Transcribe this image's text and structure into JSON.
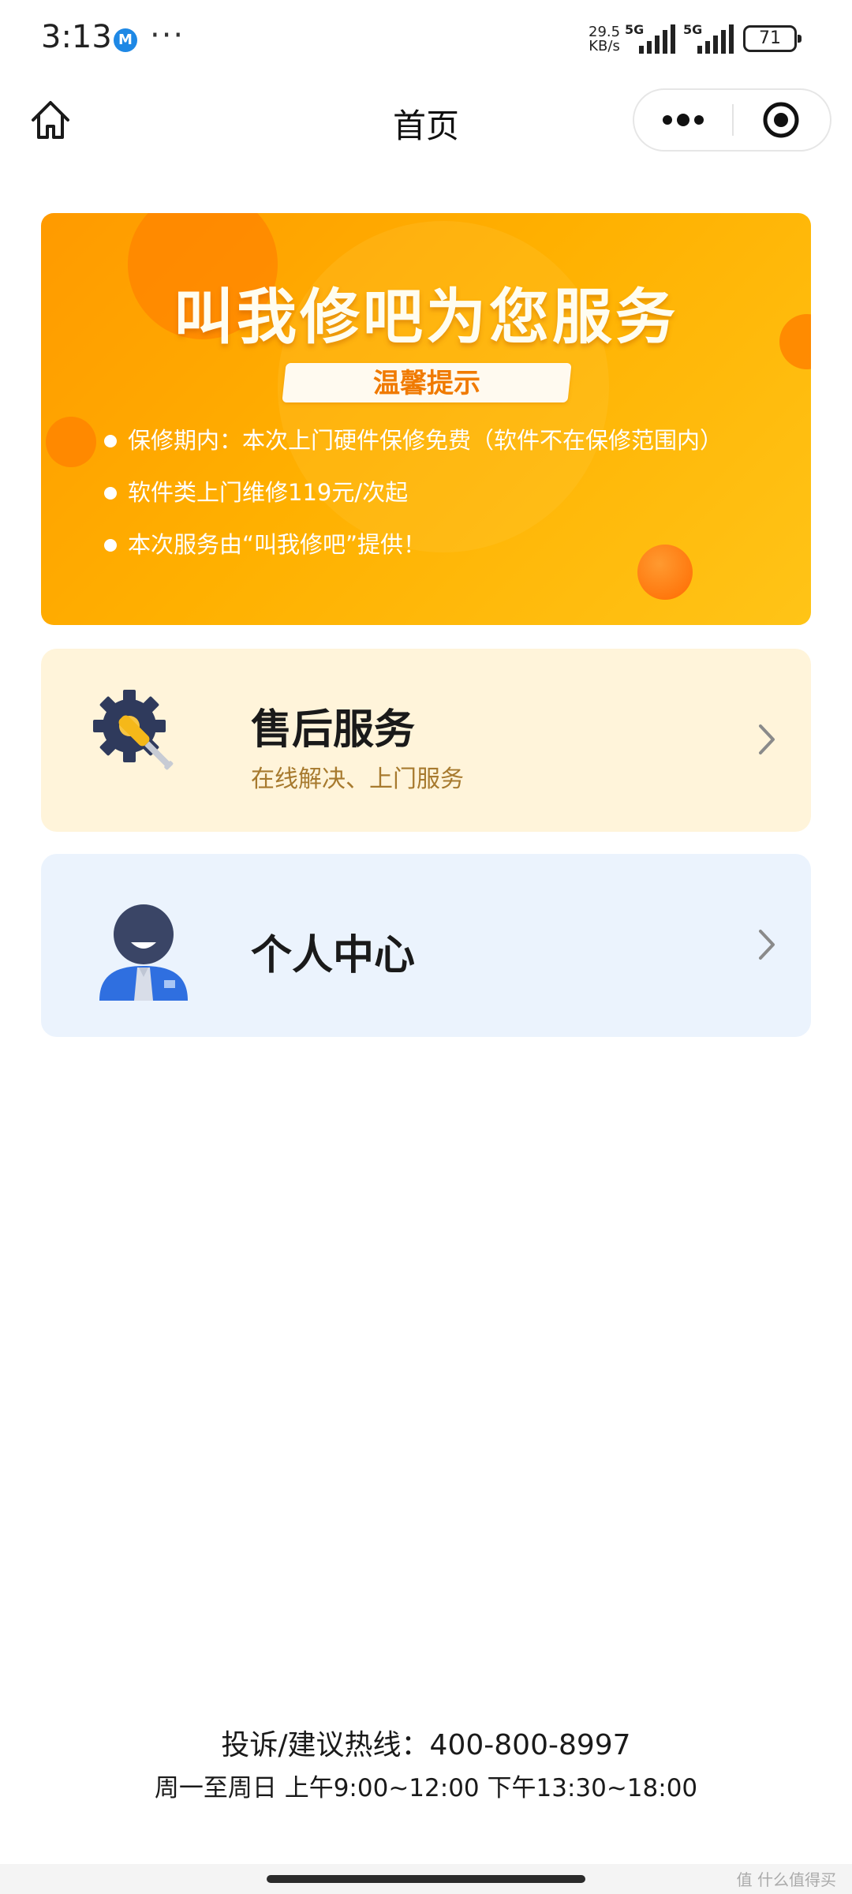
{
  "status_bar": {
    "time": "3:13",
    "app_badge": "M",
    "more": "···",
    "net_speed_value": "29.5",
    "net_speed_unit": "KB/s",
    "sim1_label": "5G",
    "sim2_label": "5G",
    "battery": "71"
  },
  "nav": {
    "title": "首页"
  },
  "banner": {
    "title": "叫我修吧为您服务",
    "tip_label": "温馨提示",
    "items": [
      "保修期内：本次上门硬件保修免费（软件不在保修范围内）",
      "软件类上门维修119元/次起",
      "本次服务由“叫我修吧”提供！"
    ]
  },
  "cards": {
    "service": {
      "title": "售后服务",
      "subtitle": "在线解决、上门服务",
      "icon": "gear-screwdriver-icon"
    },
    "personal": {
      "title": "个人中心",
      "icon": "person-icon"
    }
  },
  "footer": {
    "hotline": "投诉/建议热线：400-800-8997",
    "hours": "周一至周日 上午9:00~12:00 下午13:30~18:00"
  },
  "watermark": "值 什么值得买",
  "colors": {
    "banner_start": "#ff9a00",
    "banner_end": "#ffc417",
    "service_card_bg": "#fff4da",
    "personal_card_bg": "#ebf3fd",
    "subtitle_color": "#a77a2e"
  }
}
